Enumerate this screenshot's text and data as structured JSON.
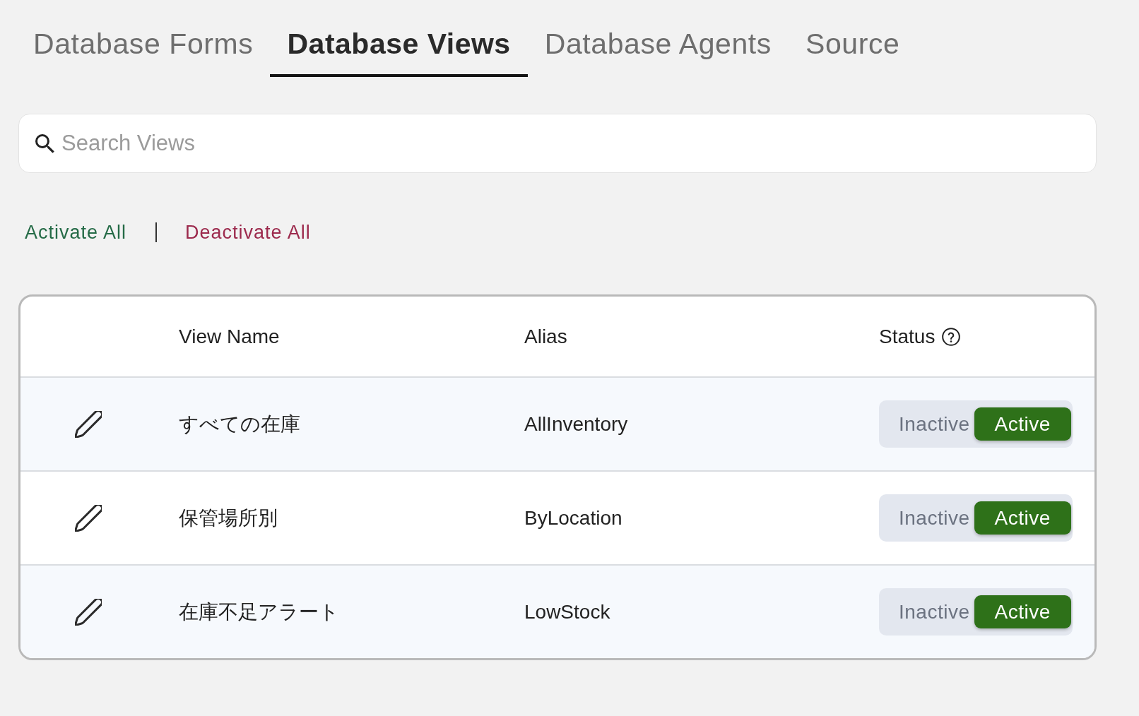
{
  "tabs": [
    {
      "label": "Database Forms",
      "selected": false
    },
    {
      "label": "Database Views",
      "selected": true
    },
    {
      "label": "Database Agents",
      "selected": false
    },
    {
      "label": "Source",
      "selected": false
    }
  ],
  "search": {
    "placeholder": "Search Views"
  },
  "bulk_actions": [
    {
      "label": "Activate All",
      "kind": "activate"
    },
    {
      "label": "Deactivate All",
      "kind": "deactivate"
    }
  ],
  "table": {
    "columns": [
      {
        "label": "View Name"
      },
      {
        "label": "Alias"
      },
      {
        "label": "Status",
        "help_icon": true
      }
    ],
    "rows": [
      {
        "view_name": "すべての在庫",
        "alias": "AllInventory",
        "status": [
          {
            "label": "Inactive",
            "selected": false
          },
          {
            "label": "Active",
            "selected": true
          }
        ]
      },
      {
        "view_name": "保管場所別",
        "alias": "ByLocation",
        "status": [
          {
            "label": "Inactive",
            "selected": false
          },
          {
            "label": "Active",
            "selected": true
          }
        ]
      },
      {
        "view_name": "在庫不足アラート",
        "alias": "LowStock",
        "status": [
          {
            "label": "Inactive",
            "selected": false
          },
          {
            "label": "Active",
            "selected": true
          }
        ]
      }
    ]
  }
}
